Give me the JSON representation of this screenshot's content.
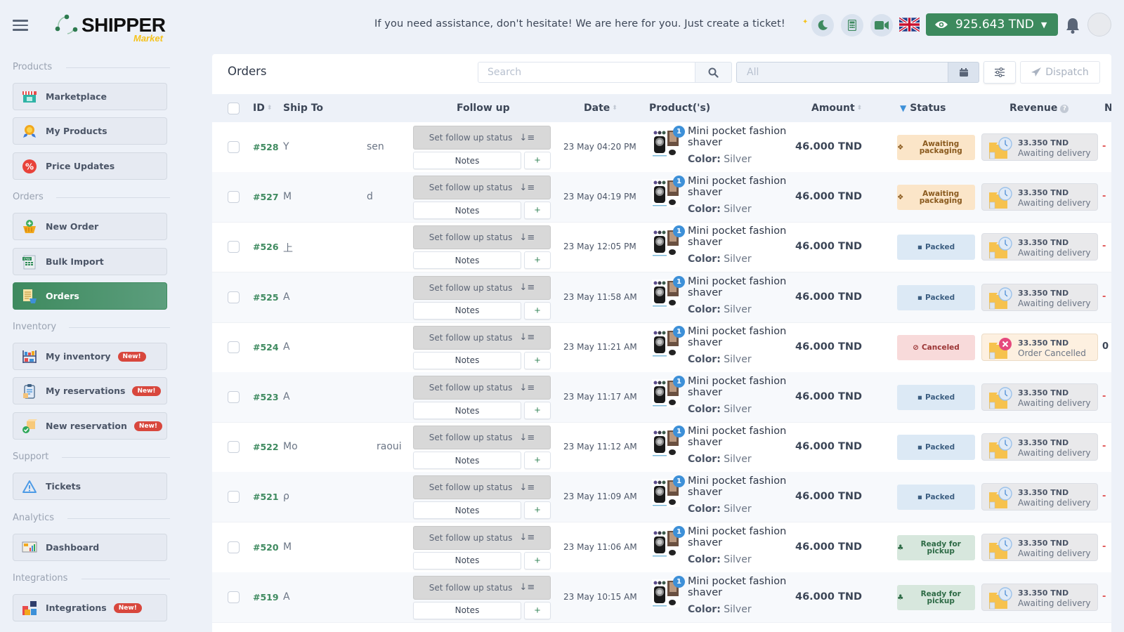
{
  "topbar": {
    "brand": "SHIPPER",
    "brand_sub": "Market",
    "assist_message": "If you need assistance, don't hesitate! We are here for you. Just create a ticket!",
    "balance": "925.643 TND",
    "icons": [
      "menu-icon",
      "moon-icon",
      "calculator-icon",
      "video-icon",
      "uk-flag-icon",
      "eye-icon",
      "caret-down-icon",
      "bell-icon",
      "avatar"
    ]
  },
  "sidebar": {
    "sections": [
      {
        "label": "Products",
        "items": [
          {
            "label": "Marketplace",
            "icon": "storefront-icon",
            "badge": ""
          },
          {
            "label": "My Products",
            "icon": "award-icon",
            "badge": ""
          },
          {
            "label": "Price Updates",
            "icon": "percent-icon",
            "badge": ""
          }
        ]
      },
      {
        "label": "Orders",
        "items": [
          {
            "label": "New Order",
            "icon": "basket-plus-icon",
            "badge": ""
          },
          {
            "label": "Bulk Import",
            "icon": "csv-icon",
            "badge": ""
          },
          {
            "label": "Orders",
            "icon": "orders-list-icon",
            "badge": "",
            "active": true
          }
        ]
      },
      {
        "label": "Inventory",
        "items": [
          {
            "label": "My inventory",
            "icon": "shelves-icon",
            "badge": "New!"
          },
          {
            "label": "My reservations",
            "icon": "clipboard-icon",
            "badge": "New!"
          },
          {
            "label": "New reservation",
            "icon": "box-check-icon",
            "badge": "New!"
          }
        ]
      },
      {
        "label": "Support",
        "items": [
          {
            "label": "Tickets",
            "icon": "warning-icon",
            "badge": ""
          }
        ]
      },
      {
        "label": "Analytics",
        "items": [
          {
            "label": "Dashboard",
            "icon": "chart-board-icon",
            "badge": ""
          }
        ]
      },
      {
        "label": "Integrations",
        "items": [
          {
            "label": "Integrations",
            "icon": "puzzle-icon",
            "badge": "New!"
          }
        ]
      }
    ]
  },
  "main": {
    "title": "Orders",
    "search_placeholder": "Search",
    "date_placeholder": "All",
    "dispatch_label": "Dispatch",
    "columns": [
      "ID",
      "Ship To",
      "Follow up",
      "Date",
      "Product('s)",
      "Amount",
      "Status",
      "Revenue",
      "N"
    ],
    "follow_up_label": "Set follow up status",
    "notes_label": "Notes",
    "plus_label": "+",
    "color_label": "Color:",
    "orders": [
      {
        "id": "#528",
        "ship_to": "Y",
        "ship_to_tail": "sen",
        "date": "23 May 04:20 PM",
        "qty": "1",
        "product": "Mini pocket fashion shaver",
        "color": "Silver",
        "amount": "46.000 TND",
        "status": "Awaiting packaging",
        "status_type": "awaiting",
        "revenue": "33.350 TND",
        "revenue_label": "Awaiting delivery",
        "margin": "-"
      },
      {
        "id": "#527",
        "ship_to": "M",
        "ship_to_tail": "d",
        "date": "23 May 04:19 PM",
        "qty": "1",
        "product": "Mini pocket fashion shaver",
        "color": "Silver",
        "amount": "46.000 TND",
        "status": "Awaiting packaging",
        "status_type": "awaiting",
        "revenue": "33.350 TND",
        "revenue_label": "Awaiting delivery",
        "margin": "-"
      },
      {
        "id": "#526",
        "ship_to": "上",
        "ship_to_tail": "",
        "date": "23 May 12:05 PM",
        "qty": "1",
        "product": "Mini pocket fashion shaver",
        "color": "Silver",
        "amount": "46.000 TND",
        "status": "Packed",
        "status_type": "packed",
        "revenue": "33.350 TND",
        "revenue_label": "Awaiting delivery",
        "margin": "-"
      },
      {
        "id": "#525",
        "ship_to": "A",
        "ship_to_tail": "",
        "date": "23 May 11:58 AM",
        "qty": "1",
        "product": "Mini pocket fashion shaver",
        "color": "Silver",
        "amount": "46.000 TND",
        "status": "Packed",
        "status_type": "packed",
        "revenue": "33.350 TND",
        "revenue_label": "Awaiting delivery",
        "margin": "-"
      },
      {
        "id": "#524",
        "ship_to": "A",
        "ship_to_tail": "",
        "date": "23 May 11:21 AM",
        "qty": "1",
        "product": "Mini pocket fashion shaver",
        "color": "Silver",
        "amount": "46.000 TND",
        "status": "Canceled",
        "status_type": "canceled",
        "revenue": "33.350 TND",
        "revenue_label": "Order Cancelled",
        "margin": "0"
      },
      {
        "id": "#523",
        "ship_to": "A",
        "ship_to_tail": "",
        "date": "23 May 11:17 AM",
        "qty": "1",
        "product": "Mini pocket fashion shaver",
        "color": "Silver",
        "amount": "46.000 TND",
        "status": "Packed",
        "status_type": "packed",
        "revenue": "33.350 TND",
        "revenue_label": "Awaiting delivery",
        "margin": "-"
      },
      {
        "id": "#522",
        "ship_to": "Mo",
        "ship_to_tail": "raoui",
        "date": "23 May 11:12 AM",
        "qty": "1",
        "product": "Mini pocket fashion shaver",
        "color": "Silver",
        "amount": "46.000 TND",
        "status": "Packed",
        "status_type": "packed",
        "revenue": "33.350 TND",
        "revenue_label": "Awaiting delivery",
        "margin": "-"
      },
      {
        "id": "#521",
        "ship_to": "ρ",
        "ship_to_tail": "",
        "date": "23 May 11:09 AM",
        "qty": "1",
        "product": "Mini pocket fashion shaver",
        "color": "Silver",
        "amount": "46.000 TND",
        "status": "Packed",
        "status_type": "packed",
        "revenue": "33.350 TND",
        "revenue_label": "Awaiting delivery",
        "margin": "-"
      },
      {
        "id": "#520",
        "ship_to": "M",
        "ship_to_tail": "",
        "date": "23 May 11:06 AM",
        "qty": "1",
        "product": "Mini pocket fashion shaver",
        "color": "Silver",
        "amount": "46.000 TND",
        "status": "Ready for pickup",
        "status_type": "ready",
        "revenue": "33.350 TND",
        "revenue_label": "Awaiting delivery",
        "margin": "-"
      },
      {
        "id": "#519",
        "ship_to": "A",
        "ship_to_tail": "",
        "date": "23 May 10:15 AM",
        "qty": "1",
        "product": "Mini pocket fashion shaver",
        "color": "Silver",
        "amount": "46.000 TND",
        "status": "Ready for pickup",
        "status_type": "ready",
        "revenue": "33.350 TND",
        "revenue_label": "Awaiting delivery",
        "margin": "-"
      }
    ]
  },
  "colors": {
    "brand_green": "#3d8a5e",
    "brand_yellow": "#f5c21b",
    "badge_red": "#d8473d",
    "qty_blue": "#3d90d8"
  }
}
